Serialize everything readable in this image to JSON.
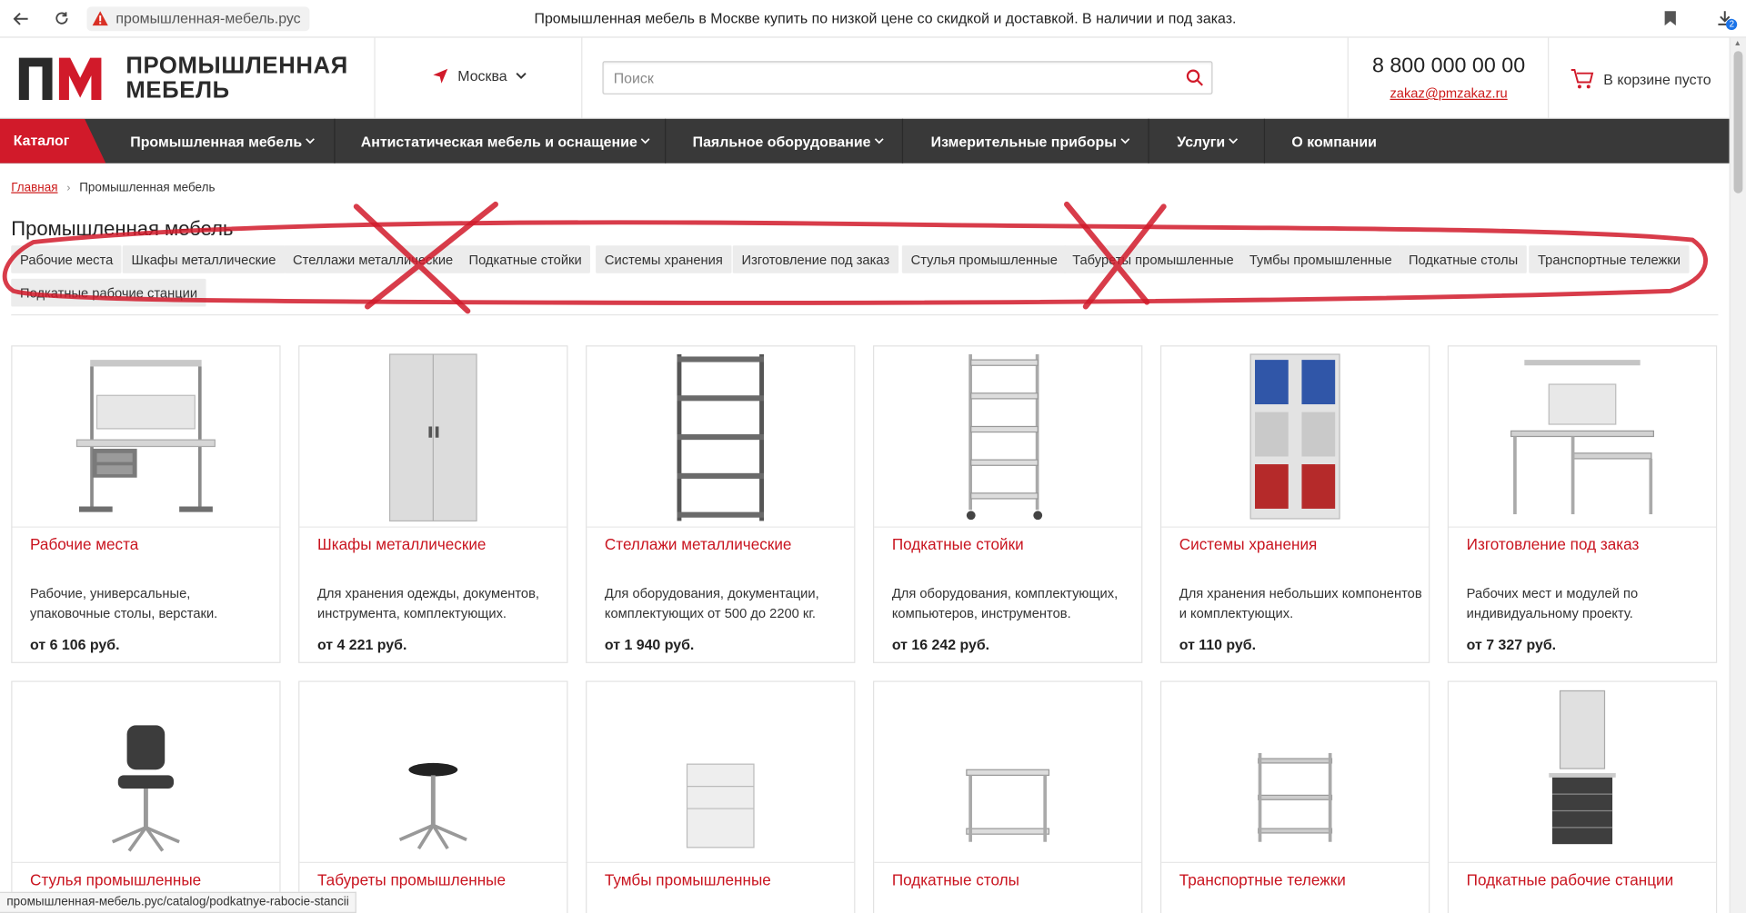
{
  "browser": {
    "address": "промышленная-мебель.рус",
    "page_title": "Промышленная мебель в Москве купить по низкой цене со скидкой и доставкой. В наличии и под заказ.",
    "download_count": "2",
    "status_url": "промышленная-мебель.рус/catalog/podkatnye-rabocie-stancii"
  },
  "header": {
    "logo_line1": "ПРОМЫШЛЕННАЯ",
    "logo_line2": "МЕБЕЛЬ",
    "city": "Москва",
    "search_placeholder": "Поиск",
    "phone": "8 800 000 00 00",
    "email": "zakaz@pmzakaz.ru",
    "cart": "В корзине пусто",
    "brand_color": "#d11a2a"
  },
  "menu": {
    "catalog": "Каталог",
    "items": [
      "Промышленная мебель",
      "Антистатическая мебель и оснащение",
      "Паяльное оборудование",
      "Измерительные приборы",
      "Услуги",
      "О компании"
    ]
  },
  "breadcrumb": {
    "home": "Главная",
    "current": "Промышленная мебель"
  },
  "page_heading": "Промышленная мебель",
  "chips": [
    "Рабочие места",
    "Шкафы металлические",
    "Стеллажи металлические",
    "Подкатные стойки",
    "Системы хранения",
    "Изготовление под заказ",
    "Стулья промышленные",
    "Табуреты промышленные",
    "Тумбы промышленные",
    "Подкатные столы",
    "Транспортные тележки",
    "Подкатные рабочие станции"
  ],
  "products": [
    {
      "title": "Рабочие места",
      "desc": "Рабочие, универсальные, упаковочные столы, верстаки.",
      "price": "от 6 106 руб.",
      "icon": "workbench-icon"
    },
    {
      "title": "Шкафы металлические",
      "desc": "Для хранения одежды, документов, инструмента, комплектующих.",
      "price": "от 4 221 руб.",
      "icon": "cabinet-icon"
    },
    {
      "title": "Стеллажи металлические",
      "desc": "Для оборудования, документации, комплектующих от 500 до 2200 кг.",
      "price": "от 1 940 руб.",
      "icon": "shelving-icon"
    },
    {
      "title": "Подкатные стойки",
      "desc": "Для оборудования, комплектующих, компьютеров, инструментов.",
      "price": "от 16 242 руб.",
      "icon": "rolling-rack-icon"
    },
    {
      "title": "Системы хранения",
      "desc": "Для хранения небольших компонентов и комплектующих.",
      "price": "от 110 руб.",
      "icon": "storage-tower-icon"
    },
    {
      "title": "Изготовление под заказ",
      "desc": "Рабочих мест и модулей по индивидуальному проекту.",
      "price": "от 7 327 руб.",
      "icon": "custom-desk-icon"
    },
    {
      "title": "Стулья промышленные",
      "desc": "",
      "price": "",
      "icon": "chair-icon"
    },
    {
      "title": "Табуреты промышленные",
      "desc": "",
      "price": "",
      "icon": "stool-icon"
    },
    {
      "title": "Тумбы промышленные",
      "desc": "",
      "price": "",
      "icon": "drawer-pedestal-icon"
    },
    {
      "title": "Подкатные столы",
      "desc": "",
      "price": "",
      "icon": "rolling-table-icon"
    },
    {
      "title": "Транспортные тележки",
      "desc": "",
      "price": "",
      "icon": "trolley-icon"
    },
    {
      "title": "Подкатные рабочие станции",
      "desc": "",
      "price": "",
      "icon": "mobile-workstation-icon"
    }
  ]
}
